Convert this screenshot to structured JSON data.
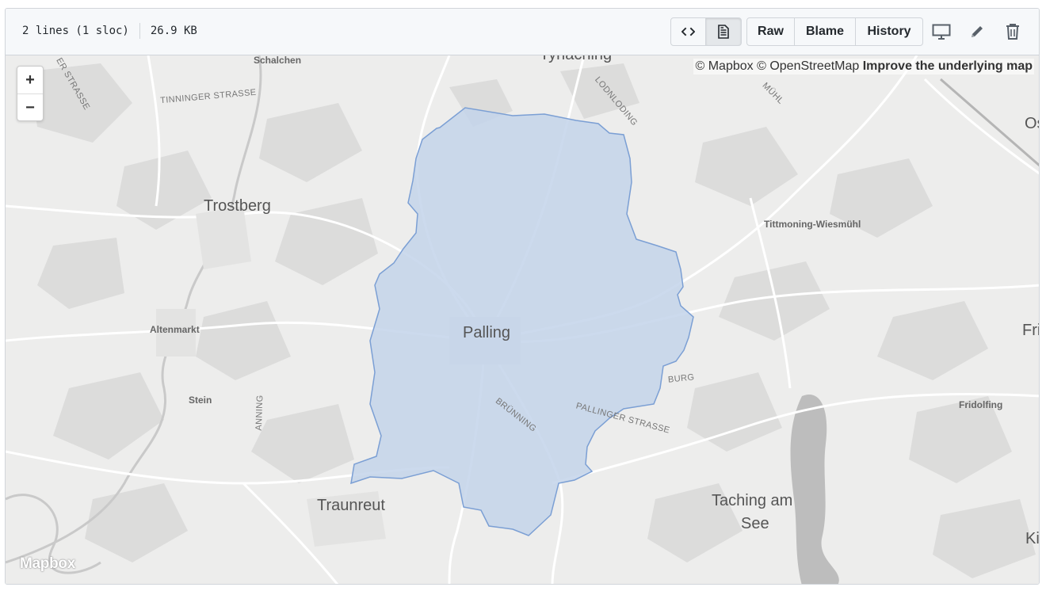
{
  "file_info": {
    "lines": "2 lines (1 sloc)",
    "size": "26.9 KB"
  },
  "toolbar": {
    "view_buttons": [
      {
        "icon": "code-icon",
        "label": "<>",
        "selected": false
      },
      {
        "icon": "file-text-icon",
        "label": "",
        "selected": true
      }
    ],
    "raw_label": "Raw",
    "blame_label": "Blame",
    "history_label": "History",
    "icons": [
      "desktop-icon",
      "pencil-icon",
      "trash-icon"
    ]
  },
  "map": {
    "zoom_in": "+",
    "zoom_out": "−",
    "attribution_mapbox": "© Mapbox",
    "attribution_osm": "© OpenStreetMap",
    "attribution_improve": "Improve the underlying map",
    "logo": "Mapbox",
    "region_fill": "#c3d3ea",
    "region_stroke": "#7b9fd4",
    "labels": {
      "palling": "Palling",
      "trostberg": "Trostberg",
      "traunreut": "Traunreut",
      "taching_1": "Taching am",
      "taching_2": "See",
      "altenmarkt": "Altenmarkt",
      "stein": "Stein",
      "tittmoning": "Tittmoning-Wiesmühl",
      "fridolfing": "Fridolfing",
      "schalchen": "Schalchen",
      "tyrlaching": "Tyrlaching",
      "tinninger": "TINNINGER STRASSE",
      "strasse_left": "ER STRASSE",
      "lodnloding": "LODNLODING",
      "muehl": "MÜHL",
      "burg": "BURG",
      "bruenning": "BRÜNNING",
      "pallinger": "PALLINGER STRASSE",
      "anning": "ANNING",
      "os": "Os",
      "fri": "Fri",
      "ki": "Ki"
    }
  }
}
